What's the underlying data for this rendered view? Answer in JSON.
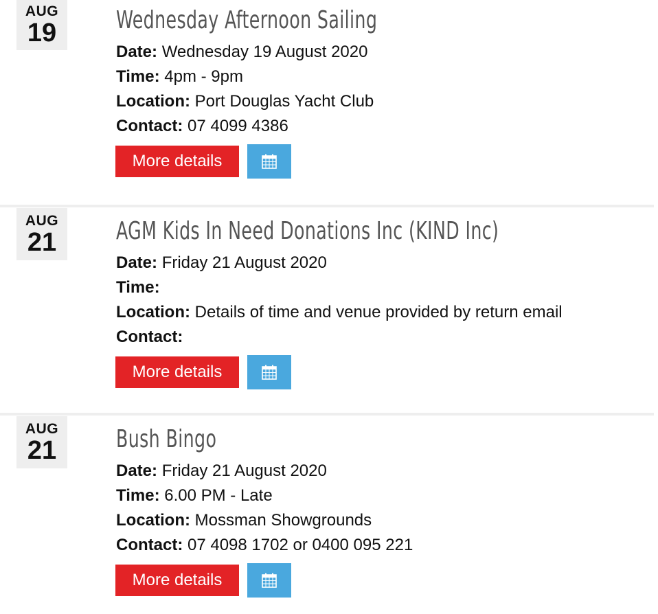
{
  "events": [
    {
      "month": "AUG",
      "day": "19",
      "title": "Wednesday Afternoon Sailing",
      "date_label": "Date:",
      "date_value": "Wednesday 19 August 2020",
      "time_label": "Time:",
      "time_value": "4pm - 9pm",
      "location_label": "Location:",
      "location_value": "Port Douglas Yacht Club",
      "contact_label": "Contact:",
      "contact_value": "07 4099 4386",
      "more_label": "More details",
      "calendar_icon": "calendar-icon"
    },
    {
      "month": "AUG",
      "day": "21",
      "title": "AGM Kids In Need Donations Inc (KIND Inc)",
      "date_label": "Date:",
      "date_value": "Friday 21 August 2020",
      "time_label": "Time:",
      "time_value": "",
      "location_label": "Location:",
      "location_value": "Details of time and venue provided by return email",
      "contact_label": "Contact:",
      "contact_value": "",
      "more_label": "More details",
      "calendar_icon": "calendar-icon"
    },
    {
      "month": "AUG",
      "day": "21",
      "title": "Bush Bingo",
      "date_label": "Date:",
      "date_value": "Friday 21 August 2020",
      "time_label": "Time:",
      "time_value": "6.00 PM - Late",
      "location_label": "Location:",
      "location_value": "Mossman Showgrounds",
      "contact_label": "Contact:",
      "contact_value": "07 4098 1702 or 0400 095 221",
      "more_label": "More details",
      "calendar_icon": "calendar-icon"
    }
  ],
  "colors": {
    "more_button": "#e32326",
    "calendar_button": "#4aa8de",
    "date_box": "#eeeeee",
    "title": "#555555"
  }
}
